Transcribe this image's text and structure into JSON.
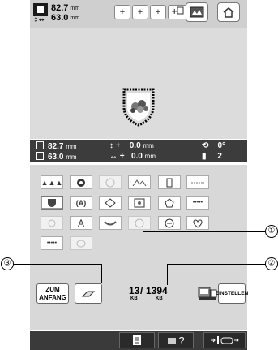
{
  "topbar": {
    "size_arrows": "↕↔",
    "height_value": "82.7",
    "width_value": "63.0",
    "unit": "mm",
    "magnify_buttons": [
      "+",
      "+",
      "+"
    ],
    "magnify_last_icon": "magnifier-icon",
    "view_button_icon": "image-view-icon",
    "home_button_icon": "home-icon"
  },
  "infobar": {
    "height": "82.7",
    "width": "63.0",
    "unit": "mm",
    "move_y_prefix": "↕ +",
    "move_y": "0.0",
    "move_x_prefix": "↔ +",
    "move_x": "0.0",
    "rotation": "0°",
    "thread_count": "2"
  },
  "grid": {
    "rows": [
      [
        "▲▲▲",
        "",
        "",
        "",
        "",
        ""
      ],
      [
        "",
        "(A)",
        "",
        "",
        "",
        "•••••"
      ],
      [
        "",
        "A",
        "",
        "",
        "",
        ""
      ],
      [
        "•••••",
        ""
      ]
    ],
    "icons": [
      [
        "triangles-icon",
        "color-wheel-icon",
        "disabled-circle-icon",
        "stitch-density-icon",
        "rectangle-frame-icon",
        "stretch-icon"
      ],
      [
        "shield-icon",
        "bracket-a-icon",
        "diamond-icon",
        "frame-image-icon",
        "pentagon-icon",
        "dots-icon"
      ],
      [
        "star-icon",
        "letter-a-icon",
        "arc-icon",
        "badge-icon",
        "circle-arrow-icon",
        "heart-icon"
      ],
      [
        "dots-icon",
        "oval-icon"
      ]
    ]
  },
  "bottom": {
    "zum_line1": "ZUM",
    "zum_line2": "ANFANG",
    "memory_used": "13",
    "memory_separator": "/",
    "memory_total": "1394",
    "kb_label": "KB",
    "einstellen": "EINSTELLEN"
  },
  "footer": {
    "help": "?",
    "arrows_icon": "arrows-frame-icon"
  },
  "callouts": [
    "①",
    "②",
    "③"
  ]
}
